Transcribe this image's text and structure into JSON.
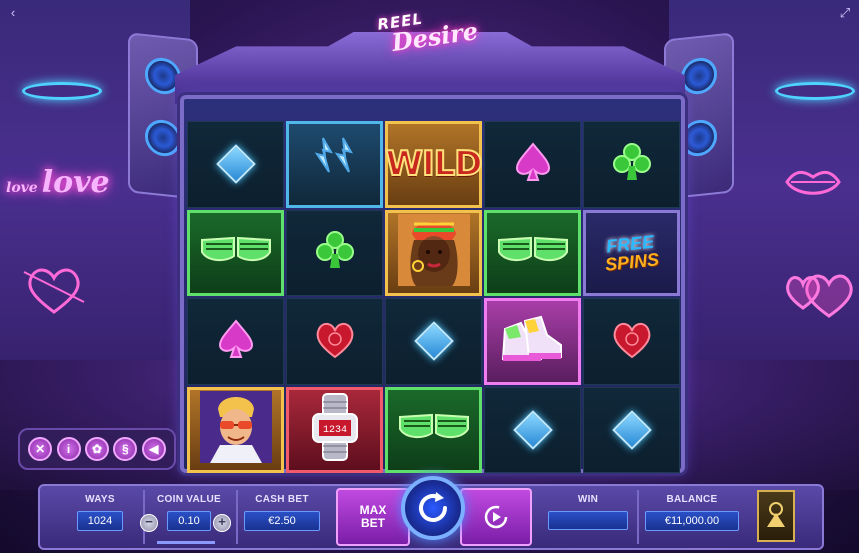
{
  "game": {
    "logo_line1": "REEL",
    "logo_line2": "Desire"
  },
  "scenery": {
    "neon_small": "love",
    "neon_big": "love"
  },
  "reels": {
    "rows": [
      [
        {
          "symbol": "blue-diamond",
          "frame": "none"
        },
        {
          "symbol": "earrings",
          "frame": "blue"
        },
        {
          "symbol": "wild",
          "frame": "gold",
          "text": "WILD"
        },
        {
          "symbol": "pink-spade",
          "frame": "none"
        },
        {
          "symbol": "green-club",
          "frame": "none"
        }
      ],
      [
        {
          "symbol": "green-shutter-shades",
          "frame": "green"
        },
        {
          "symbol": "green-club",
          "frame": "none"
        },
        {
          "symbol": "woman-with-cap",
          "frame": "gold"
        },
        {
          "symbol": "green-shutter-shades",
          "frame": "green"
        },
        {
          "symbol": "free-spins-boombox",
          "frame": "boom",
          "text_free": "FREE",
          "text_spins": "SPINS"
        }
      ],
      [
        {
          "symbol": "pink-spade",
          "frame": "none"
        },
        {
          "symbol": "red-heart",
          "frame": "none"
        },
        {
          "symbol": "blue-diamond",
          "frame": "none"
        },
        {
          "symbol": "sneakers",
          "frame": "pink"
        },
        {
          "symbol": "red-heart",
          "frame": "none"
        }
      ],
      [
        {
          "symbol": "man-with-sunglasses",
          "frame": "gold"
        },
        {
          "symbol": "digital-watch",
          "frame": "red"
        },
        {
          "symbol": "green-shutter-shades",
          "frame": "green"
        },
        {
          "symbol": "blue-diamond",
          "frame": "none"
        },
        {
          "symbol": "blue-diamond",
          "frame": "none"
        }
      ]
    ]
  },
  "side_menu": {
    "close": "✕",
    "info": "i",
    "settings": "✿",
    "rules": "§",
    "sound": "◀"
  },
  "controls": {
    "ways_label": "WAYS",
    "ways_value": "1024",
    "coin_value_label": "COIN VALUE",
    "coin_value": "0.10",
    "coin_minus": "−",
    "coin_plus": "+",
    "cash_bet_label": "CASH BET",
    "cash_bet_value": "€2.50",
    "max_bet_line1": "MAX",
    "max_bet_line2": "BET",
    "win_label": "WIN",
    "win_value": "",
    "balance_label": "BALANCE",
    "balance_value": "€11,000.00"
  },
  "colors": {
    "accent_pink": "#c04ae0",
    "accent_blue": "#2a50c8",
    "neon_cyan": "#4fd2ff"
  }
}
